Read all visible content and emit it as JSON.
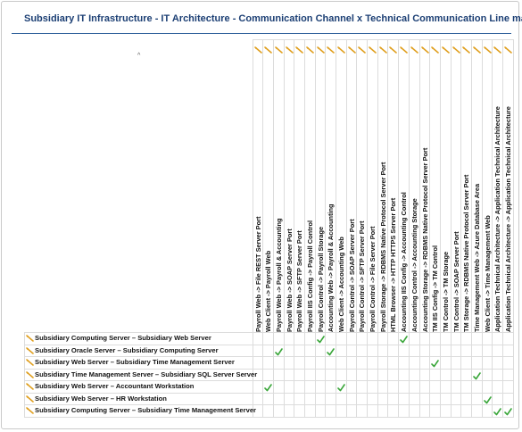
{
  "title": "Subsidiary IT Infrastructure - IT Architecture - Communication Channel x Technical Communication Line matrix",
  "colors": {
    "title": "#1c3f74",
    "check": "#3aa63a",
    "marker": "#e0a020",
    "grid": "#dcdcdc"
  },
  "sort_indicator": "^",
  "columns": [
    "Payroll Web -> File REST Server Port",
    "Web Client -> Payroll Web",
    "Payroll Web -> Payroll & Accounting",
    "Payroll Web -> SOAP Server Port",
    "Payroll Web -> SFTP Server Port",
    "Payroll IIS Config -> Payroll Control",
    "Payroll Control -> Payroll Storage",
    "Accounting Web -> Payroll & Accounting",
    "Web Client -> Accounting Web",
    "Payroll Control -> SOAP Server Port",
    "Payroll Control -> SFTP Server Port",
    "Payroll Control -> File Server Port",
    "Payroll Storage -> RDBMS Native Protocol Server Port",
    "HTML Browser -> HTTP HTTPS Server Port",
    "Accounting IIS Config -> Accounting Control",
    "Accounting Control -> Accounting Storage",
    "Accounting Storage -> RDBMS Native Protocol Server Port",
    "TM IIS Config -> TM Control",
    "TM Control -> TM Storage",
    "TM Control -> SOAP Server Port",
    "TM Storage -> RDBMS Native Protocol Server Port",
    "Time Management Web -> Azure Database Area",
    "Web Client -> Time Management Web",
    "Application Technical Architecture -> Application Technical Architecture",
    "Application Technical Architecture -> Application Technical Architecture"
  ],
  "rows": [
    {
      "label": "Subsidiary Computing Server – Subsidiary Web Server",
      "checks": [
        6,
        14
      ]
    },
    {
      "label": "Subsidiary Oracle Server – Subsidiary Computing Server",
      "checks": [
        2,
        7
      ]
    },
    {
      "label": "Subsidiary Web Server – Subsidiary Time Management Server",
      "checks": [
        17
      ]
    },
    {
      "label": "Subsidiary Time Management Server – Subsidiary SQL Server Server",
      "checks": [
        21
      ]
    },
    {
      "label": "Subsidiary Web Server – Accountant Workstation",
      "checks": [
        1,
        8
      ]
    },
    {
      "label": "Subsidiary Web Server – HR Workstation",
      "checks": [
        22
      ]
    },
    {
      "label": "Subsidiary Computing Server – Subsidiary Time Management Server",
      "checks": [
        23,
        24
      ]
    }
  ]
}
